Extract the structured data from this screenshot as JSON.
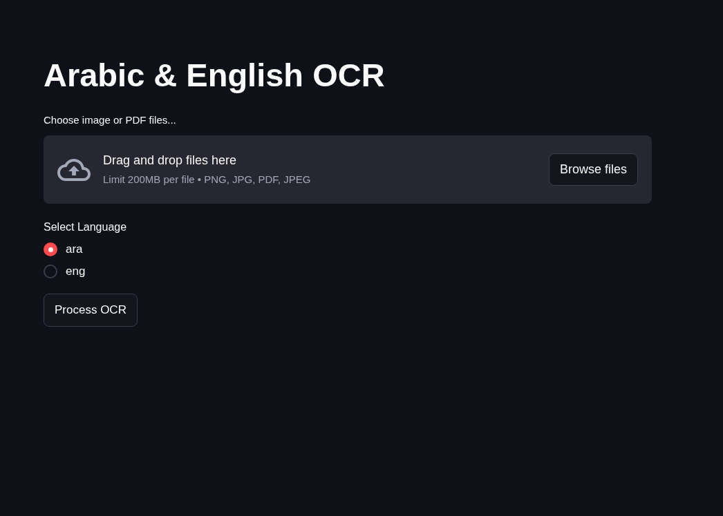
{
  "title": "Arabic & English OCR",
  "file_uploader": {
    "label": "Choose image or PDF files...",
    "instructions": "Drag and drop files here",
    "limits": "Limit 200MB per file • PNG, JPG, PDF, JPEG",
    "button": "Browse files"
  },
  "language": {
    "label": "Select Language",
    "options": [
      {
        "label": "ara",
        "selected": true
      },
      {
        "label": "eng",
        "selected": false
      }
    ]
  },
  "process_button": "Process OCR"
}
